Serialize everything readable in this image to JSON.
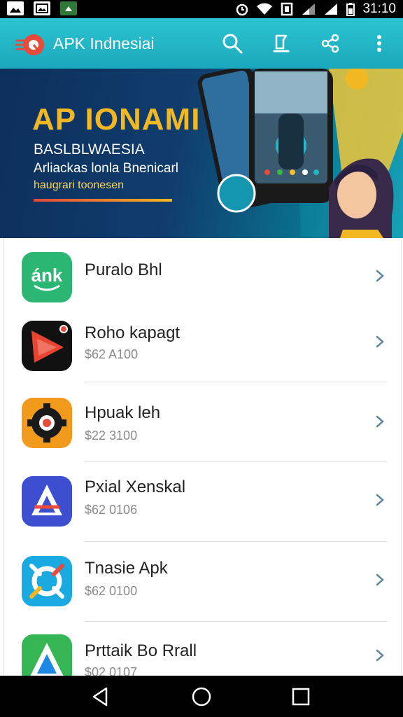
{
  "status_bar": {
    "time": "31:10"
  },
  "app_bar": {
    "title": "APK Indnesiai"
  },
  "banner": {
    "title": "AP IONAMI",
    "subtitle1": "BASLBLWAESIA",
    "subtitle2": "Arliackas lonla Bnenicarl",
    "subtitle3": "haugrari toonesen"
  },
  "apps": [
    {
      "name": "Puralo Bhl",
      "price": "",
      "icon_text": "ánk"
    },
    {
      "name": "Roho kapagt",
      "price": "$62 A100"
    },
    {
      "name": "Hpuak leh",
      "price": "$22 3100"
    },
    {
      "name": "Pxial Xenskal",
      "price": "$62 0106"
    },
    {
      "name": "Tnasie Apk",
      "price": "$62 0100"
    },
    {
      "name": "Prttaik Bo Rrall",
      "price": "$02 0107"
    }
  ],
  "colors": {
    "accent": "#1fb6c6",
    "chevron": "#5f8a9a"
  }
}
